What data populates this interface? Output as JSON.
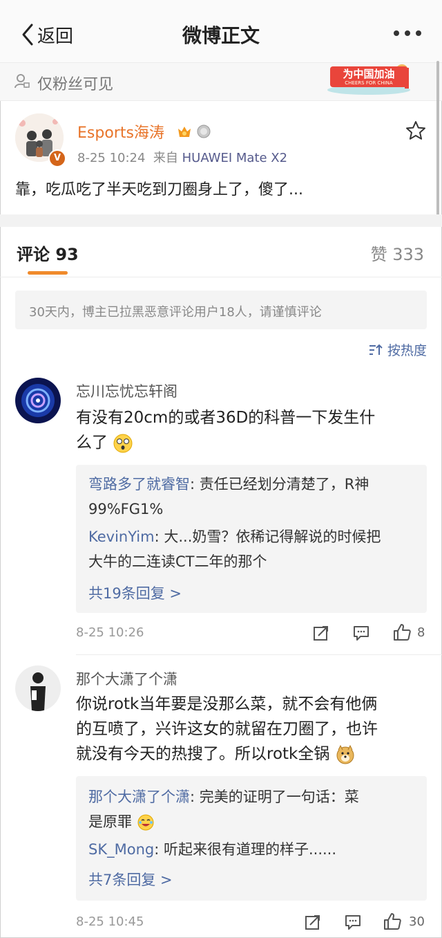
{
  "nav": {
    "back_label": "返回",
    "title": "微博正文"
  },
  "visibility": {
    "text": "仅粉丝可见",
    "banner_text": "为中国加油",
    "banner_sub": "CHEERS FOR CHINA"
  },
  "post": {
    "author": "Esports海涛",
    "verified_mark": "V",
    "time": "8-25 10:24",
    "source_prefix": "来自",
    "device": "HUAWEI Mate X2",
    "text": "靠，吃瓜吃了半天吃到刀圈身上了，傻了..."
  },
  "tabs": {
    "comments_label": "评论 93",
    "likes_label": "赞 333"
  },
  "notice": "30天内，博主已拉黑恶意评论用户18人，请谨慎评论",
  "sort_label": "按热度",
  "comments": [
    {
      "name": "忘川忘忧忘轩阁",
      "text_line1": "有没有20cm的或者36D的科普一下发生什",
      "text_line2": "么了",
      "replies": [
        {
          "name": "弯路多了就睿智",
          "text": ": 责任已经划分清楚了，R神",
          "cont": "99%FG1%"
        },
        {
          "name": "KevinYim",
          "text": ": 大...奶雪？依稀记得解说的时候把",
          "cont": "大牛的二连读CT二年的那个"
        }
      ],
      "more_replies": "共19条回复 >",
      "time": "8-25 10:26",
      "likes": "8"
    },
    {
      "name": "那个大潇了个潇",
      "text_line1": "你说rotk当年要是没那么菜，就不会有他俩",
      "text_line2": "的互喷了，兴许这女的就留在刀圈了，也许",
      "text_line3": "就没有今天的热搜了。所以rotk全锅",
      "replies": [
        {
          "name": "那个大潇了个潇",
          "text": ": 完美的证明了一句话：菜",
          "cont": "是原罪"
        },
        {
          "name": "SK_Mong",
          "text": ": 听起来很有道理的样子......"
        }
      ],
      "more_replies": "共7条回复 >",
      "time": "8-25 10:45",
      "likes": "30"
    }
  ],
  "colors": {
    "accent_orange": "#f08a2b",
    "link_blue": "#4f6ba3",
    "author_orange": "#e8742a"
  }
}
